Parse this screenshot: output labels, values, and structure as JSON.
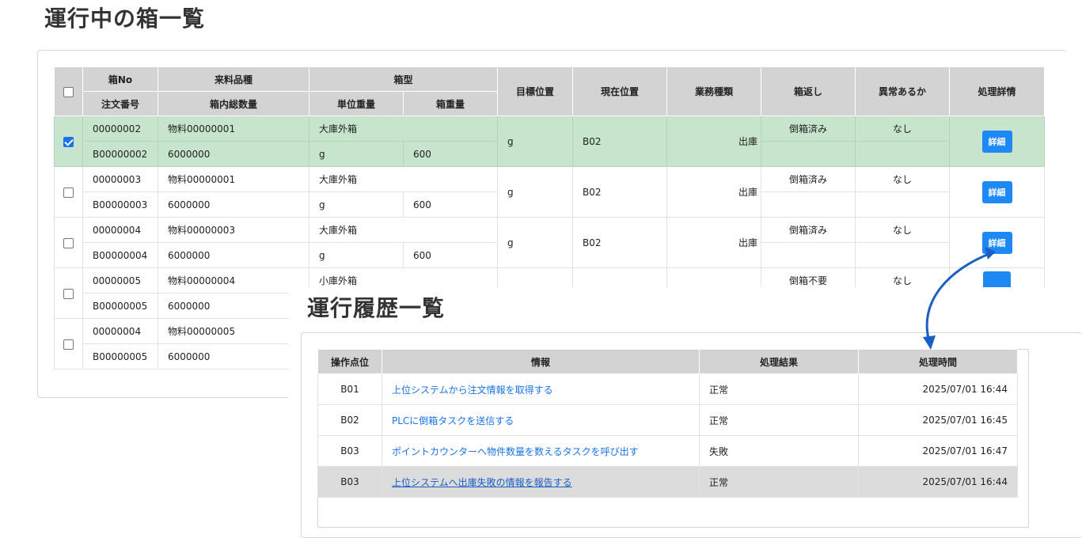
{
  "main_title": "運行中の箱一覧",
  "history_title": "運行履歴一覧",
  "box_table": {
    "headers": {
      "box_no": "箱No",
      "material": "来料品種",
      "box_type": "箱型",
      "target": "目標位置",
      "current": "現在位置",
      "business": "業務種類",
      "return": "箱返し",
      "abnormal": "異常あるか",
      "detail": "処理詳情",
      "order_no": "注文番号",
      "box_qty": "箱内総数量",
      "unit_weight": "単位重量",
      "box_weight": "箱重量"
    },
    "rows": [
      {
        "checked": true,
        "box_no": "00000002",
        "material": "物料00000001",
        "box_type": "大庫外箱",
        "target": "g",
        "current": "B02",
        "business": "出庫",
        "return": "倒箱済み",
        "abnormal": "なし",
        "detail": "詳細",
        "order_no": "B00000002",
        "box_qty": "6000000",
        "unit_weight": "g",
        "box_weight": "600"
      },
      {
        "checked": false,
        "box_no": "00000003",
        "material": "物料00000001",
        "box_type": "大庫外箱",
        "target": "g",
        "current": "B02",
        "business": "出庫",
        "return": "倒箱済み",
        "abnormal": "なし",
        "detail": "詳細",
        "order_no": "B00000003",
        "box_qty": "6000000",
        "unit_weight": "g",
        "box_weight": "600"
      },
      {
        "checked": false,
        "box_no": "00000004",
        "material": "物料00000003",
        "box_type": "大庫外箱",
        "target": "g",
        "current": "B02",
        "business": "出庫",
        "return": "倒箱済み",
        "abnormal": "なし",
        "detail": "詳細",
        "order_no": "B00000004",
        "box_qty": "6000000",
        "unit_weight": "g",
        "box_weight": "600"
      },
      {
        "checked": false,
        "box_no": "00000005",
        "material": "物料00000004",
        "box_type": "小庫外箱",
        "target": "",
        "current": "",
        "business": "",
        "return": "倒箱不要",
        "abnormal": "なし",
        "detail": "",
        "order_no": "B00000005",
        "box_qty": "6000000",
        "unit_weight": "",
        "box_weight": ""
      },
      {
        "checked": false,
        "box_no": "00000004",
        "material": "物料00000005",
        "box_type": "",
        "target": "",
        "current": "",
        "business": "",
        "return": "",
        "abnormal": "",
        "detail": "",
        "order_no": "B00000005",
        "box_qty": "6000000",
        "unit_weight": "",
        "box_weight": ""
      }
    ]
  },
  "history_table": {
    "headers": {
      "point": "操作点位",
      "info": "情報",
      "result": "処理結果",
      "time": "処理時間"
    },
    "rows": [
      {
        "point": "B01",
        "info": "上位システムから注文情報を取得する",
        "result": "正常",
        "time": "2025/07/01 16:44"
      },
      {
        "point": "B02",
        "info": "PLCに倒箱タスクを送信する",
        "result": "正常",
        "time": "2025/07/01 16:45"
      },
      {
        "point": "B03",
        "info": "ポイントカウンターへ物件数量を数えるタスクを呼び出す",
        "result": "失敗",
        "time": "2025/07/01 16:47"
      },
      {
        "point": "B03",
        "info": "上位システムへ出庫失敗の情報を報告する",
        "result": "正常",
        "time": "2025/07/01 16:44"
      }
    ]
  },
  "colors": {
    "selected_row": "#c6e5cc",
    "button": "#1e88f5",
    "link": "#1a73e8",
    "header": "#d3d3d3",
    "arrow": "#1a5fc4"
  }
}
